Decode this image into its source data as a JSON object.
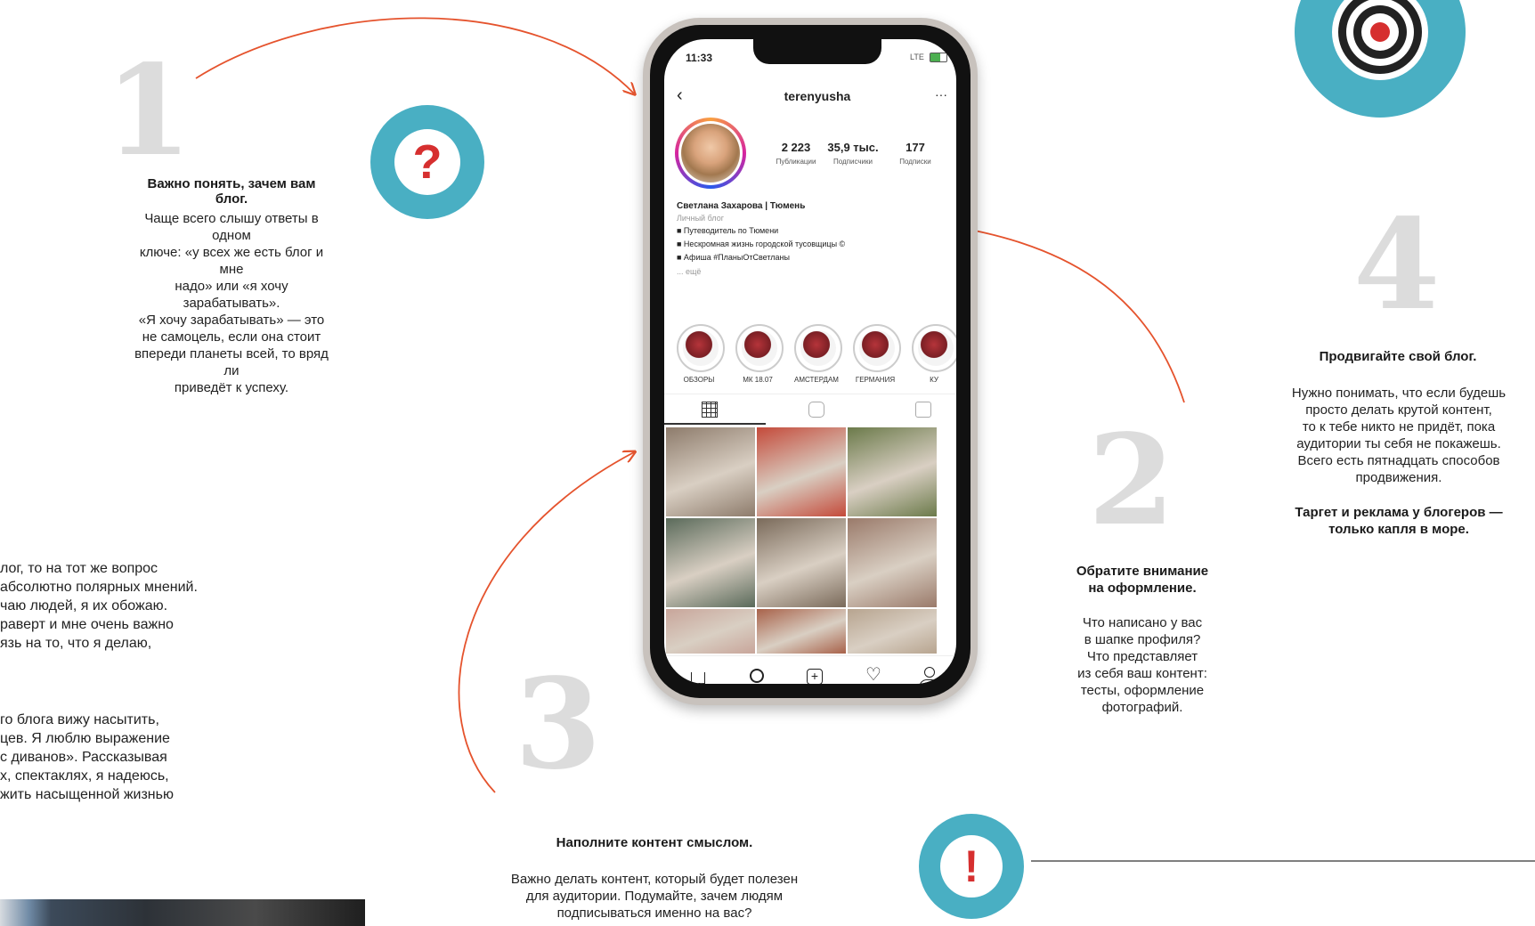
{
  "colors": {
    "accent_arrow": "#e5532d",
    "circle_teal": "#49afc3",
    "number_gray": "#dcdcdc",
    "alert_red": "#d62f2f"
  },
  "section1": {
    "number": "1",
    "title": "Важно понять, зачем вам блог.",
    "lines": [
      "Чаще всего слышу ответы в одном",
      "ключе: «у всех же есть блог и мне",
      "надо» или «я хочу зарабатывать».",
      "«Я хочу зарабатывать» — это",
      "не самоцель, если она стоит",
      "впереди планеты всей, то вряд ли",
      "приведёт к успеху."
    ]
  },
  "section2": {
    "number": "2",
    "title_lines": [
      "Обратите внимание",
      "на оформление."
    ],
    "lines": [
      "Что написано у вас",
      "в шапке профиля?",
      "Что представляет",
      "из себя ваш контент:",
      "тесты, оформление",
      "фотографий."
    ]
  },
  "section3": {
    "number": "3",
    "title": "Наполните контент смыслом.",
    "lines": [
      "Важно делать контент, который будет полезен",
      "для аудитории. Подумайте, зачем людям",
      "подписываться именно на вас?"
    ]
  },
  "section4": {
    "number": "4",
    "title": "Продвигайте свой блог.",
    "lines": [
      "Нужно понимать, что если будешь",
      "просто делать крутой контент,",
      "то к тебе никто не придёт, пока",
      "аудитории ты себя не покажешь.",
      "Всего есть пятнадцать способов",
      "продвижения."
    ],
    "bold_lines": [
      "Таргет и реклама у блогеров —",
      "только капля в море."
    ]
  },
  "left_body": {
    "para1": [
      "лог, то на тот же вопрос",
      "абсолютно полярных мнений.",
      "чаю людей, я их обожаю.",
      "раверт и мне очень важно",
      "язь на то, что я делаю,"
    ],
    "para2": [
      "го блога вижу насытить,",
      "цев. Я люблю выражение",
      "с диванов». Рассказывая",
      "х, спектаклях, я надеюсь,",
      "жить насыщенной жизнью"
    ]
  },
  "icons": {
    "question": "?",
    "exclamation": "!"
  },
  "phone": {
    "time": "11:33",
    "signal": "LTE",
    "username": "terenyusha",
    "stats": [
      {
        "value": "2 223",
        "label": "Публикации"
      },
      {
        "value": "35,9 тыс.",
        "label": "Подписчики"
      },
      {
        "value": "177",
        "label": "Подписки"
      }
    ],
    "name": "Светлана Захарова | Тюмень",
    "category": "Личный блог",
    "bio": [
      "■ Путеводитель по Тюмени",
      "■ Нескромная жизнь городской тусовщицы ©",
      "■ Афиша #ПланыОтСветланы"
    ],
    "more": "... ещё",
    "highlights": [
      "ОБЗОРЫ",
      "МК 18.07",
      "АМСТЕРДАМ",
      "ГЕРМАНИЯ",
      "КУ"
    ],
    "grid_colors": [
      "#8d7b6b",
      "#c44a3a",
      "#6b7a4a",
      "#5a6a5a",
      "#7a6a5a",
      "#9a7a6a",
      "#c8a59a",
      "#a8624a",
      "#b7a48f"
    ]
  }
}
